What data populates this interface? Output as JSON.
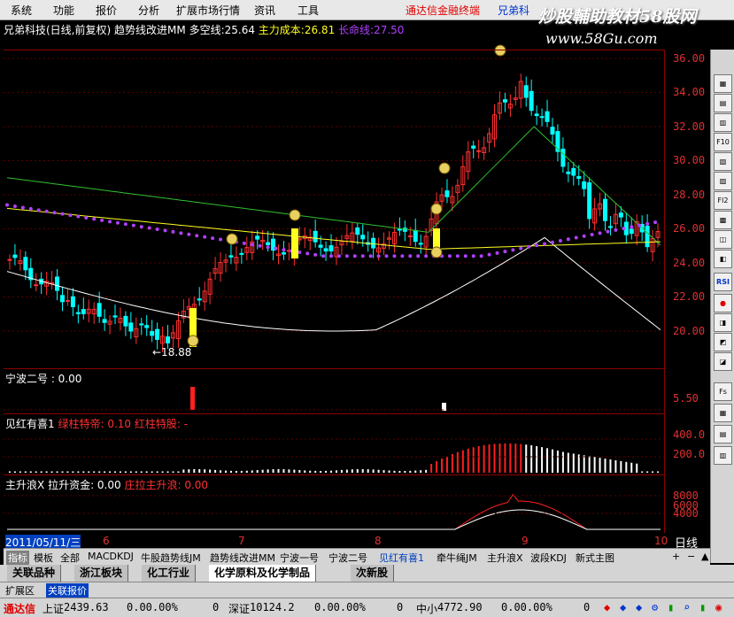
{
  "menu": [
    "系统",
    "功能",
    "报价",
    "分析",
    "扩展市场行情",
    "资讯",
    "工具"
  ],
  "brand": "通达信金融终端",
  "brand_user": "兄弟科",
  "watermark": "炒股輔助教材58股网",
  "watermark_url": "www.58Gu.com",
  "header": {
    "stock": "兄弟科技(日线,前复权)",
    "indicator": "趋势线改进MM",
    "duokong_label": "多空线:",
    "duokong_value": "25.64",
    "chengben_label": "主力成本:",
    "chengben_value": "26.81",
    "changming_label": "长命线:",
    "changming_value": "27.50"
  },
  "low_label": "←18.88",
  "y_ticks": [
    "36.00",
    "34.00",
    "32.00",
    "30.00",
    "28.00",
    "26.00",
    "24.00",
    "22.00",
    "20.00"
  ],
  "panel2": {
    "title": "宁波二号 : 0.00",
    "tick": "5.50"
  },
  "panel3": {
    "name": "见红有喜1",
    "l1": "绿柱特帝: 0.10",
    "l2": "红柱特股: -",
    "ticks": [
      "400.0",
      "200.0"
    ]
  },
  "panel4": {
    "name": "主升浪X",
    "l1": "拉升资金: 0.00",
    "l2": "庄拉主升浪: 0.00",
    "ticks": [
      "8000",
      "6000",
      "4000"
    ]
  },
  "datebar": {
    "date": "2011/05/11/三",
    "months": [
      "6",
      "7",
      "8",
      "9",
      "10"
    ],
    "period": "日线"
  },
  "indicator_tabs": [
    "指标",
    "模板",
    "全部",
    "MACD",
    "KDJ",
    "牛股趋势线JM",
    "趋势线改进MM",
    "宁波一号",
    "宁波二号",
    "见红有喜1",
    "牵牛绳JM",
    "主升浪X",
    "波段KDJ",
    "新式主图"
  ],
  "sector_tabs": [
    "关联品种",
    "浙江板块",
    "化工行业",
    "化学原料及化学制品",
    "次新股"
  ],
  "bottom_tabs": [
    "扩展区",
    "关联报价"
  ],
  "status": {
    "brand": "通达信",
    "sh_label": "上证",
    "sh_value": "2439.63",
    "sh_chg": "0.00.00%",
    "sh_vol": "0",
    "sz_label": "深证",
    "sz_value": "10124.2",
    "sz_chg": "0.00.00%",
    "sz_vol": "0",
    "zx_label": "中小",
    "zx_value": "4772.90",
    "zx_chg": "0.00.00%",
    "zx_vol": "0"
  },
  "right_buttons": [
    "F10",
    "Fl2",
    "RSI",
    "Fs"
  ],
  "colors": {
    "up": "#ff3030",
    "down": "#00ffff",
    "purple": "#b040ff",
    "yellow": "#ffff20",
    "green": "#30c030",
    "white": "#ffffff",
    "axis": "#8b0000"
  }
}
